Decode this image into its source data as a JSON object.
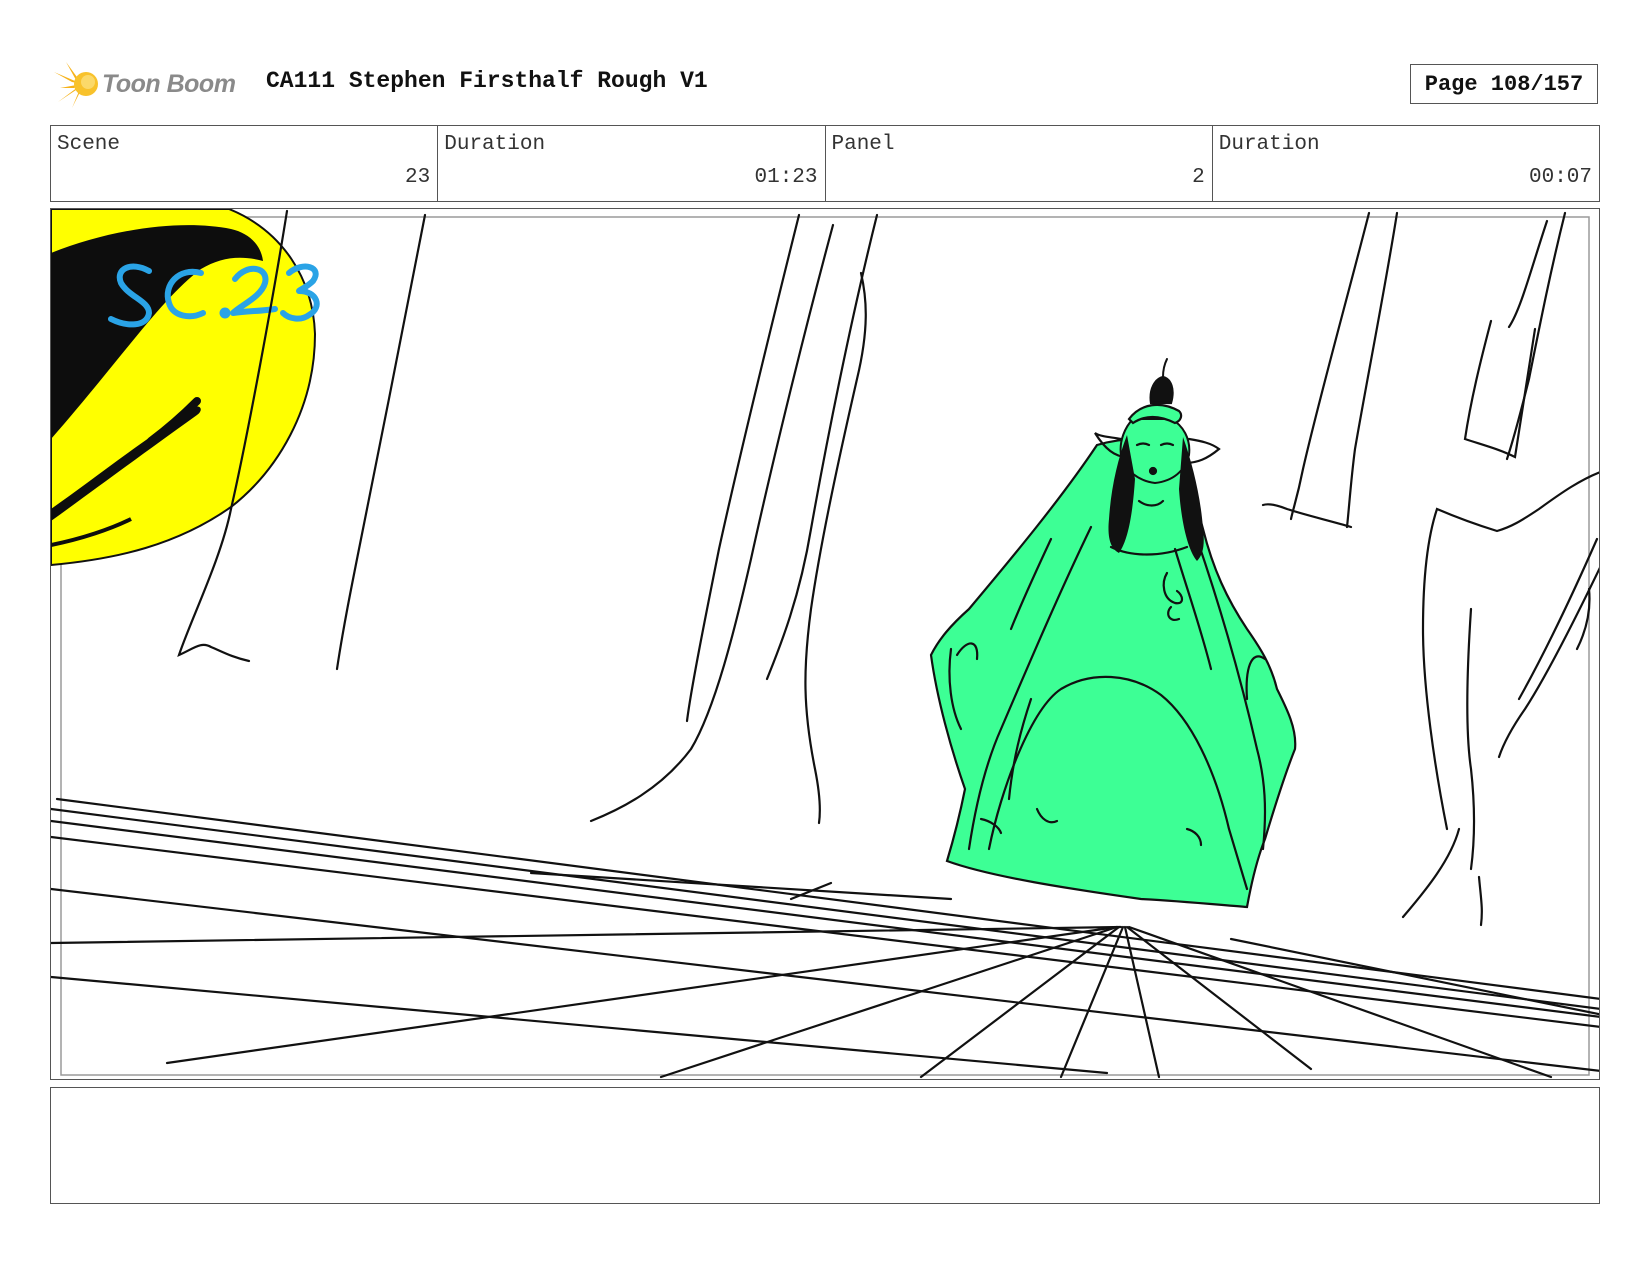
{
  "header": {
    "logo_text": "Toon Boom",
    "title": "CA111 Stephen Firsthalf Rough V1",
    "page": "Page 108/157"
  },
  "info": {
    "scene_label": "Scene",
    "scene_value": "23",
    "scene_duration_label": "Duration",
    "scene_duration_value": "01:23",
    "panel_label": "Panel",
    "panel_value": "2",
    "panel_duration_label": "Duration",
    "panel_duration_value": "00:07"
  },
  "panel": {
    "sketch_annotation": "SC.23",
    "colors": {
      "moon": "#ffff00",
      "figure": "#3dff95",
      "annotation": "#2aa3e6",
      "ink": "#111111"
    }
  },
  "notes": {
    "text": ""
  }
}
